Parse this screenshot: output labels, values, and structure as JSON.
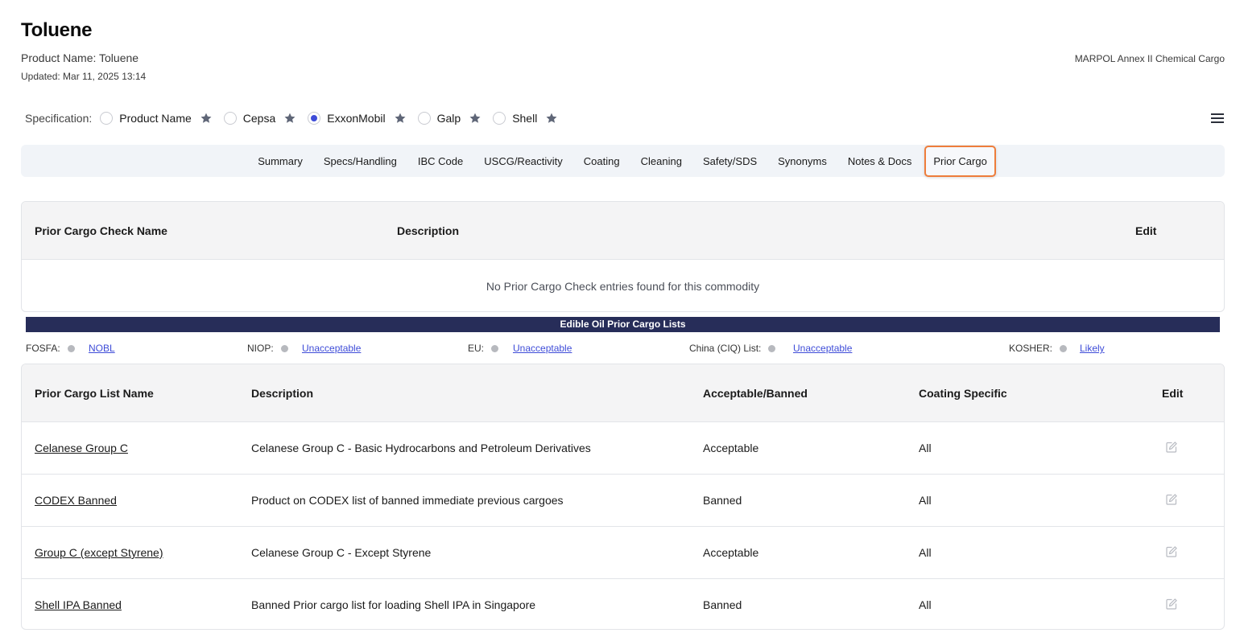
{
  "header": {
    "title": "Toluene",
    "product_name": "Product Name: Toluene",
    "updated": "Updated: Mar 11, 2025 13:14",
    "annex": "MARPOL Annex II Chemical Cargo"
  },
  "specification": {
    "label": "Specification:",
    "options": [
      {
        "label": "Product Name",
        "selected": false
      },
      {
        "label": "Cepsa",
        "selected": false
      },
      {
        "label": "ExxonMobil",
        "selected": true
      },
      {
        "label": "Galp",
        "selected": false
      },
      {
        "label": "Shell",
        "selected": false
      }
    ]
  },
  "tabs": [
    "Summary",
    "Specs/Handling",
    "IBC Code",
    "USCG/Reactivity",
    "Coating",
    "Cleaning",
    "Safety/SDS",
    "Synonyms",
    "Notes & Docs",
    "Prior Cargo"
  ],
  "active_tab": "Prior Cargo",
  "prior_cargo_check": {
    "headers": {
      "name": "Prior Cargo Check Name",
      "description": "Description",
      "edit": "Edit"
    },
    "empty_message": "No Prior Cargo Check entries found for this commodity"
  },
  "edible_oil": {
    "banner": "Edible Oil Prior Cargo Lists",
    "items": [
      {
        "label": "FOSFA:",
        "value": "NOBL"
      },
      {
        "label": "NIOP:",
        "value": "Unacceptable"
      },
      {
        "label": "EU:",
        "value": "Unacceptable"
      },
      {
        "label": "China (CIQ) List:",
        "value": "Unacceptable"
      },
      {
        "label": "KOSHER:",
        "value": "Likely"
      }
    ]
  },
  "prior_cargo_lists": {
    "headers": {
      "name": "Prior Cargo List Name",
      "description": "Description",
      "acceptable": "Acceptable/Banned",
      "coating": "Coating Specific",
      "edit": "Edit"
    },
    "rows": [
      {
        "name": "Celanese Group C",
        "description": "Celanese Group C - Basic Hydrocarbons and Petroleum Derivatives",
        "acceptable": "Acceptable",
        "coating": "All"
      },
      {
        "name": "CODEX Banned",
        "description": "Product on CODEX list of banned immediate previous cargoes",
        "acceptable": "Banned",
        "coating": "All"
      },
      {
        "name": "Group C (except Styrene)",
        "description": "Celanese Group C - Except Styrene",
        "acceptable": "Acceptable",
        "coating": "All"
      },
      {
        "name": "Shell IPA Banned",
        "description": "Banned Prior cargo list for loading Shell IPA in Singapore",
        "acceptable": "Banned",
        "coating": "All"
      }
    ]
  },
  "colors": {
    "accent": "#3e4cd8",
    "active_tab_border": "#ee7d3b",
    "banner": "#272d59",
    "star": "#5f6677",
    "tabs_bg": "#f1f4f8"
  },
  "icons": {
    "star": "star-icon",
    "menu": "hamburger-menu-icon",
    "edit": "edit-icon",
    "status_dot": "status-dot-icon"
  }
}
